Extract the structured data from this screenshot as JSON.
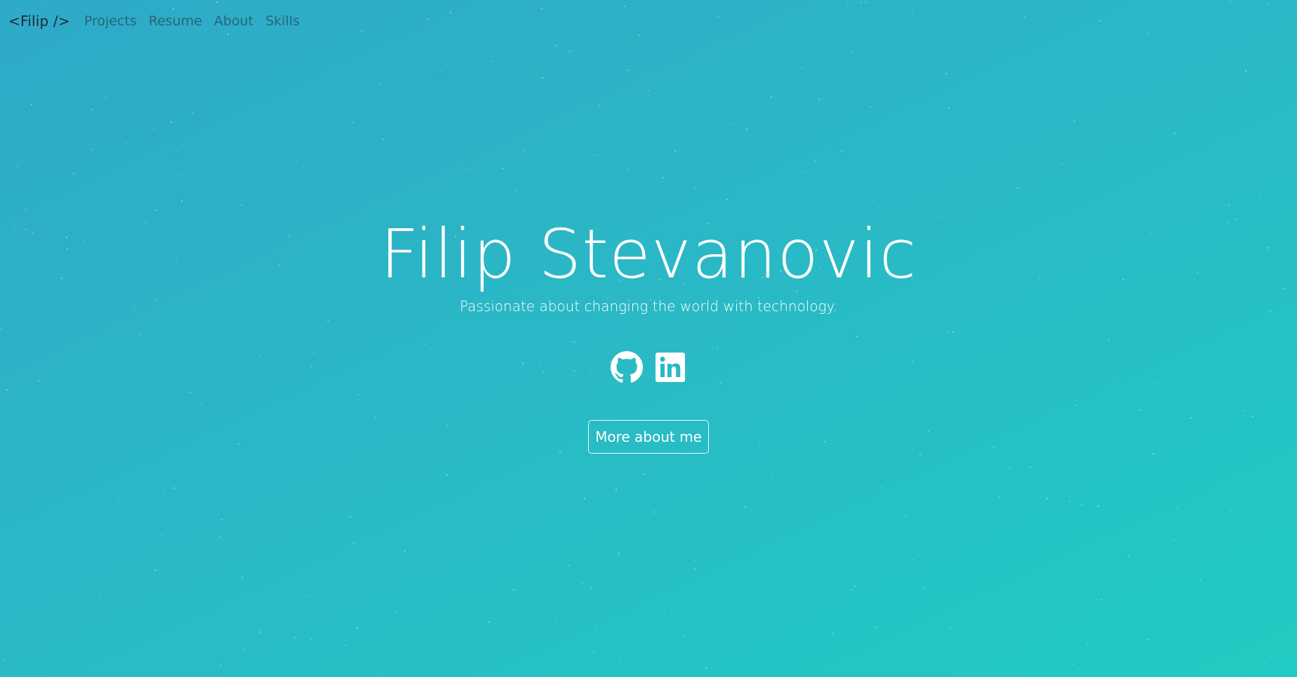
{
  "nav": {
    "brand": "<Filip />",
    "links": [
      "Projects",
      "Resume",
      "About",
      "Skills"
    ]
  },
  "hero": {
    "title": "Filip Stevanovic",
    "subtitle": "Passionate about changing the world with technology.",
    "socials": [
      {
        "icon": "github-icon"
      },
      {
        "icon": "linkedin-icon"
      }
    ],
    "cta_label": "More about me"
  },
  "colors": {
    "gradient_start": "#2fa9c8",
    "gradient_end": "#21cbc2",
    "text": "#ffffff",
    "brand": "#1e2a30"
  }
}
